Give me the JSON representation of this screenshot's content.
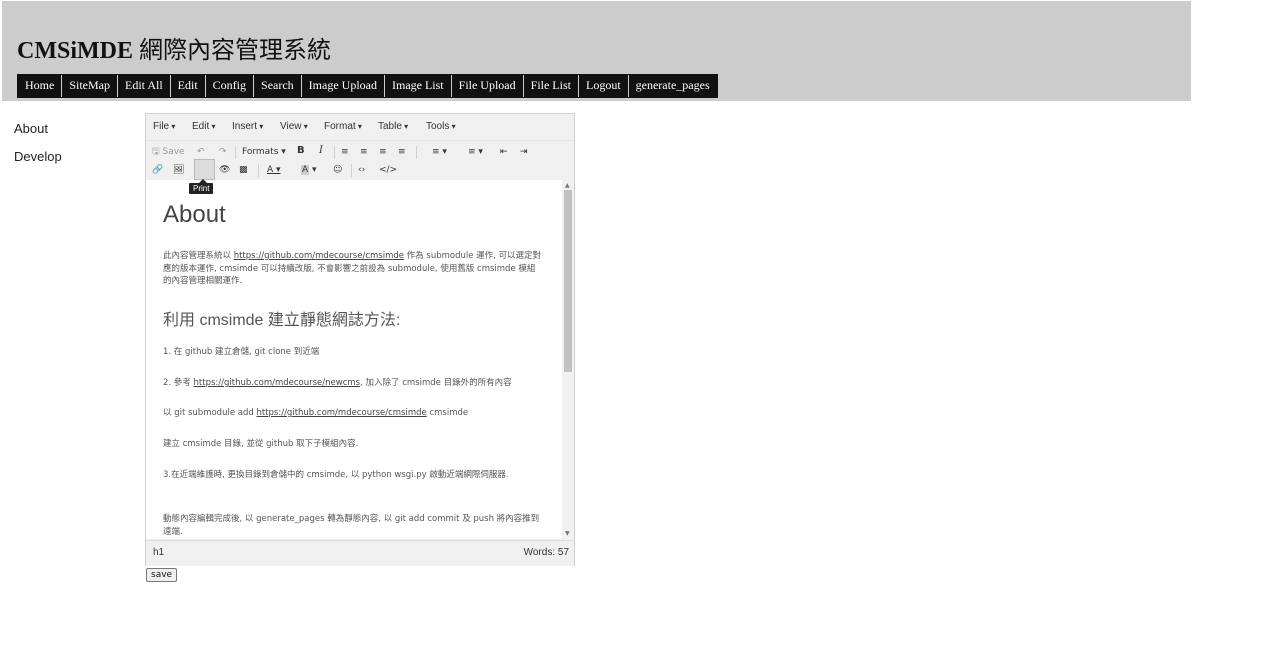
{
  "site": {
    "title_latin": "CMSiMDE",
    "title_cjk": "網際內容管理系統"
  },
  "nav": [
    "Home",
    "SiteMap",
    "Edit All",
    "Edit",
    "Config",
    "Search",
    "Image Upload",
    "Image List",
    "File Upload",
    "File List",
    "Logout",
    "generate_pages"
  ],
  "sidebar": [
    "About",
    "Develop"
  ],
  "editor": {
    "menus": [
      "File",
      "Edit",
      "Insert",
      "View",
      "Format",
      "Table",
      "Tools"
    ],
    "toolbar": {
      "save": "Save",
      "formats": "Formats",
      "bold": "B",
      "italic": "I"
    },
    "tooltip": "Print",
    "content": {
      "h1": "About",
      "p1_before": "此內容管理系統以 ",
      "p1_link": "https://github.com/mdecourse/cmsimde",
      "p1_after": " 作為 submodule 運作, 可以選定對應的版本運作, cmsimde 可以持續改版, 不會影響之前設為 submodule, 使用舊版 cmsimde 模組的內容管理相關運作.",
      "h2": "利用 cmsimde 建立靜態網誌方法:",
      "p2": "1. 在 github 建立倉儲, git clone 到近端",
      "p3_before": "2. 參考 ",
      "p3_link": "https://github.com/mdecourse/newcms",
      "p3_after": ", 加入除了 cmsimde 目錄外的所有內容",
      "p4_before": "以 git submodule add ",
      "p4_link": "https://github.com/mdecourse/cmsimde",
      "p4_after": " cmsimde",
      "p5": "建立 cmsimde 目錄, 並從 github 取下子模組內容.",
      "p6": "3.在近端維護時, 更換目錄到倉儲中的 cmsimde, 以 python wsgi.py 啟動近端網際伺服器.",
      "p7": "動態內容編輯完成後, 以 generate_pages 轉為靜態內容, 以 git add commit 及 push 將內容推到遠端."
    },
    "status": {
      "path": "h1",
      "words": "Words: 57"
    }
  },
  "save_button": "save"
}
